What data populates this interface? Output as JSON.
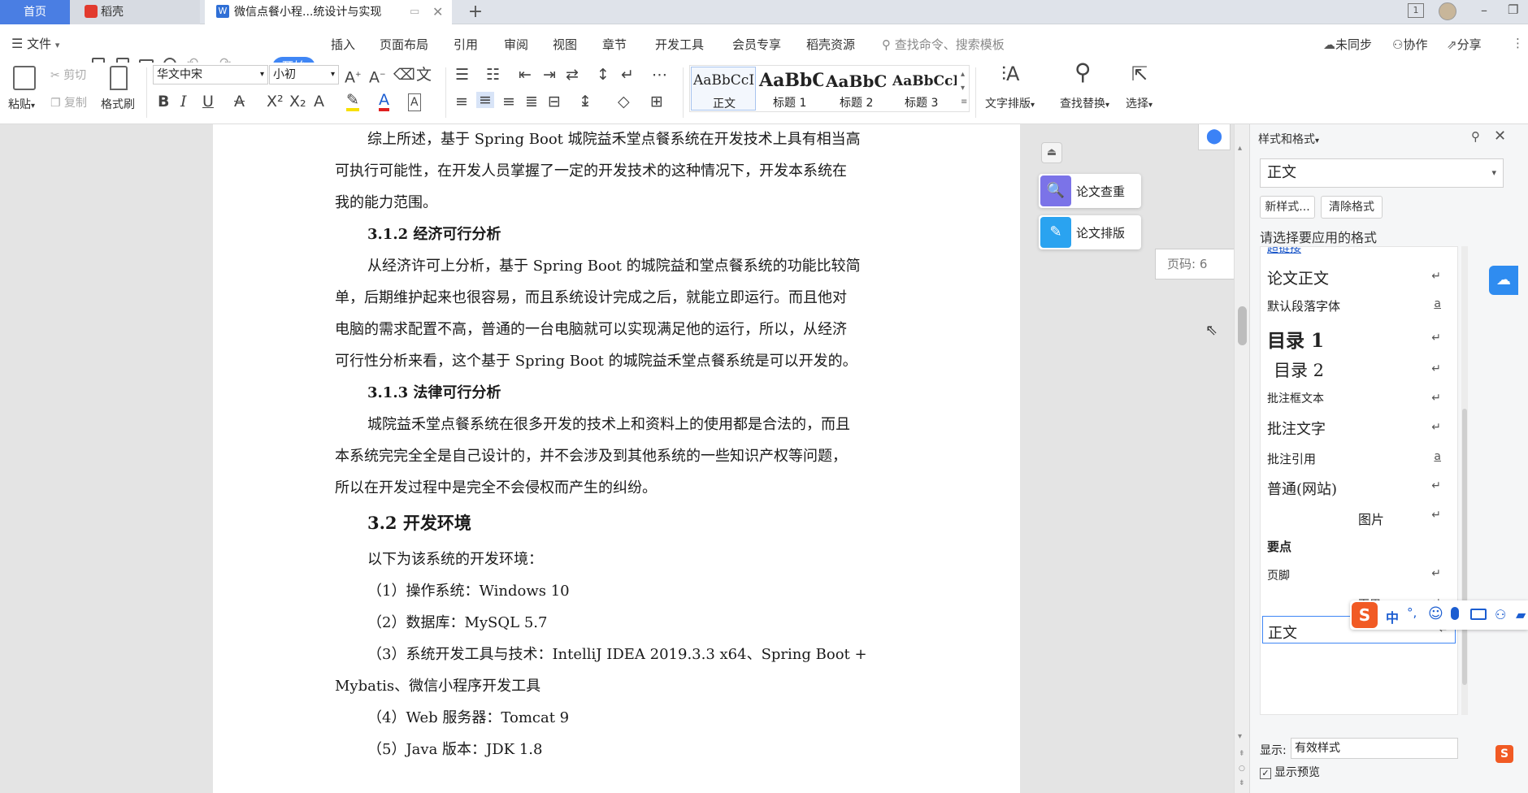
{
  "tabs": {
    "home": "首页",
    "daoke": "稻壳",
    "doc": "微信点餐小程...统设计与实现",
    "new": "+"
  },
  "window": {
    "min": "–",
    "max": "❐"
  },
  "menu": {
    "file": "文件",
    "items": [
      "开始",
      "插入",
      "页面布局",
      "引用",
      "审阅",
      "视图",
      "章节",
      "开发工具",
      "会员专享",
      "稻壳资源"
    ],
    "search": "查找命令、搜索模板",
    "sync": "未同步",
    "collab": "协作",
    "share": "分享"
  },
  "ribbon": {
    "paste": "粘贴",
    "cut": "剪切",
    "copy": "复制",
    "format_painter": "格式刷",
    "font_name": "华文中宋",
    "font_size": "小初",
    "styles": [
      {
        "preview": "AaBbCcI",
        "name": "正文"
      },
      {
        "preview": "AaBbC",
        "name": "标题 1"
      },
      {
        "preview": "AaBbC",
        "name": "标题 2"
      },
      {
        "preview": "AaBbCcI",
        "name": "标题 3"
      }
    ],
    "text_layout": "文字排版",
    "find_replace": "查找替换",
    "select": "选择"
  },
  "doc": {
    "lines": [
      "综上所述，基于 Spring Boot 城院益禾堂点餐系统在开发技术上具有相当高",
      "可执行可能性，在开发人员掌握了一定的开发技术的这种情况下，开发本系统在",
      "我的能力范围。",
      "3.1.2  经济可行分析",
      "从经济许可上分析，基于 Spring Boot 的城院益和堂点餐系统的功能比较简",
      "单，后期维护起来也很容易，而且系统设计完成之后，就能立即运行。而且他对",
      "电脑的需求配置不高，普通的一台电脑就可以实现满足他的运行，所以，从经济",
      "可行性分析来看，这个基于 Spring Boot 的城院益禾堂点餐系统是可以开发的。",
      "3.1.3  法律可行分析",
      "城院益禾堂点餐系统在很多开发的技术上和资料上的使用都是合法的，而且",
      "本系统完完全全是自己设计的，并不会涉及到其他系统的一些知识产权等问题，",
      "所以在开发过程中是完全不会侵权而产生的纠纷。",
      "3.2    开发环境",
      "以下为该系统的开发环境：",
      "（1）操作系统：Windows 10",
      "（2）数据库：MySQL 5.7",
      "（3）系统开发工具与技术：IntelliJ IDEA 2019.3.3 x64、Spring Boot +",
      "Mybatis、微信小程序开发工具",
      "（4）Web 服务器：Tomcat 9",
      "（5）Java 版本：JDK 1.8"
    ]
  },
  "float": {
    "check": "论文查重",
    "layout": "论文排版",
    "page_no": "页码: 6"
  },
  "panel": {
    "title": "样式和格式",
    "current": "正文",
    "new_style": "新样式...",
    "clear": "清除格式",
    "choose": "请选择要应用的格式",
    "hyperlink": "超链接",
    "list": [
      "论文正文",
      "默认段落字体",
      "目录 1",
      "目录 2",
      "批注框文本",
      "批注文字",
      "批注引用",
      "普通(网站)",
      "图片",
      "要点",
      "页脚",
      "页眉",
      "正文"
    ],
    "show_label": "显示:",
    "show_value": "有效样式",
    "preview_label": "显示预览"
  },
  "ime": {
    "items": [
      "中",
      "°,",
      "☺",
      "🎤",
      "⌨"
    ]
  }
}
